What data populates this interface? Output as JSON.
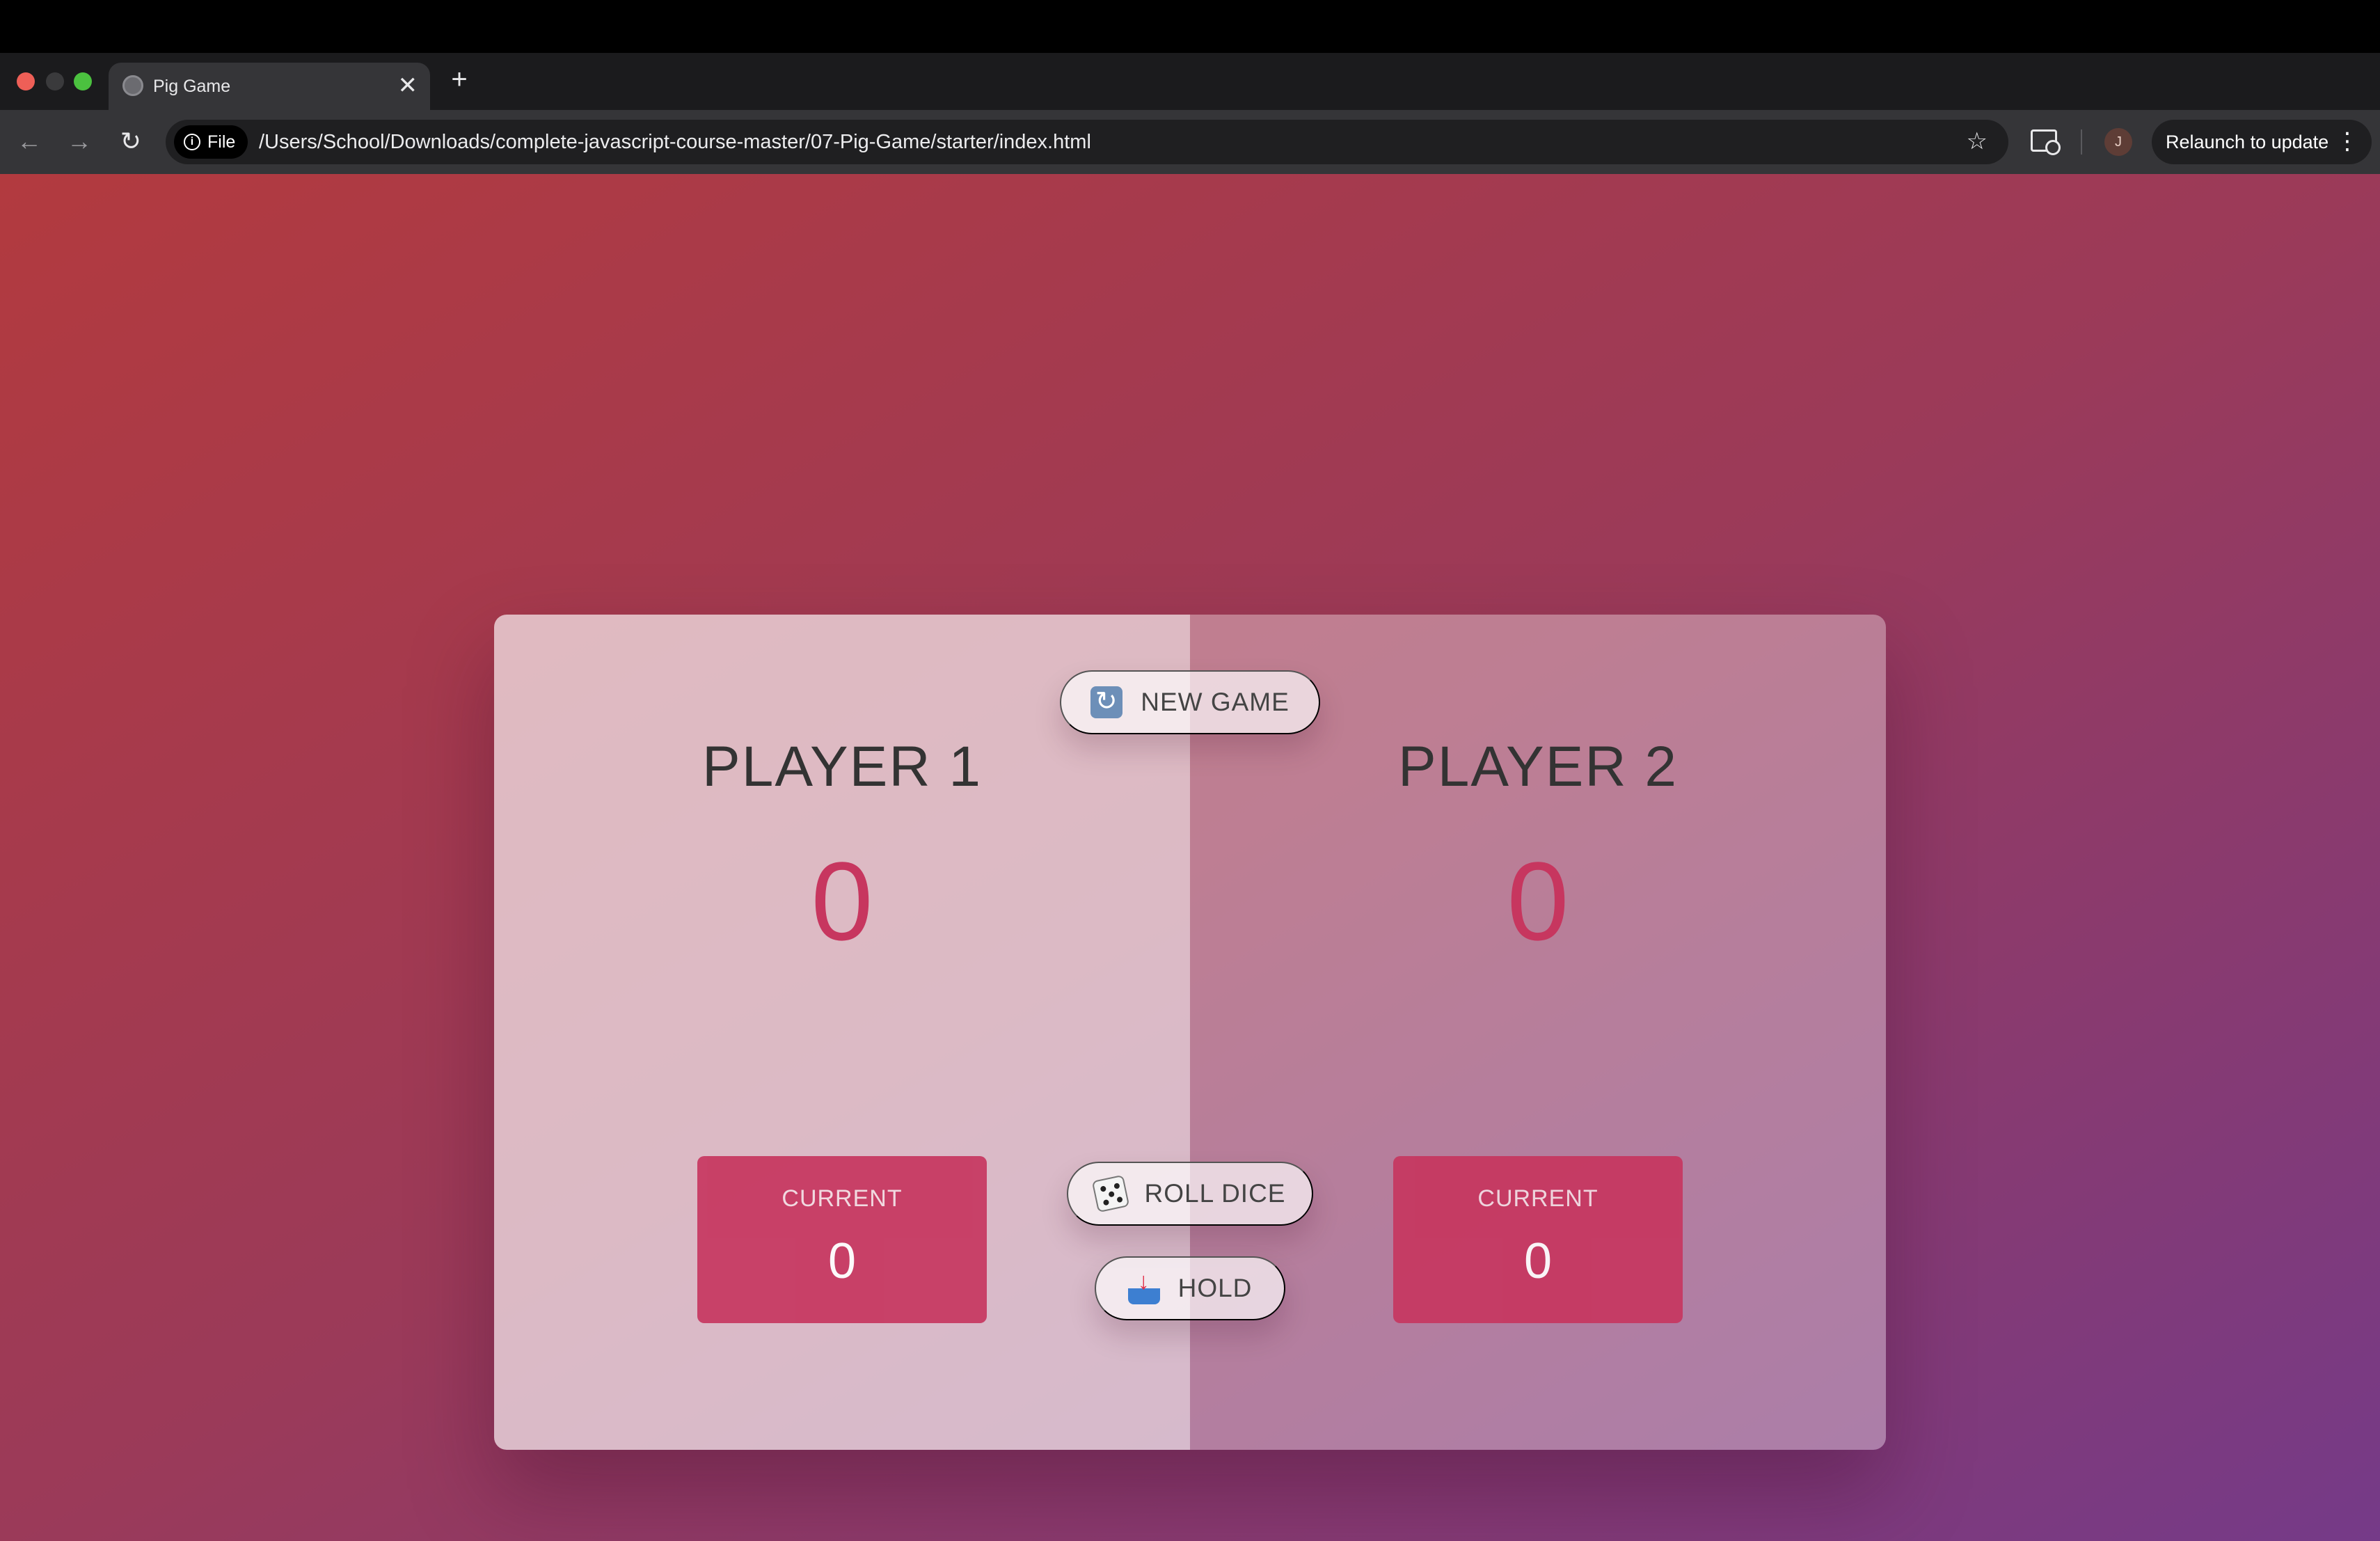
{
  "browser": {
    "tab_title": "Pig Game",
    "tab_close": "✕",
    "new_tab": "+",
    "back": "←",
    "forward": "→",
    "reload": "↻",
    "file_chip": "File",
    "info": "i",
    "url": "/Users/School/Downloads/complete-javascript-course-master/07-Pig-Game/starter/index.html",
    "bookmark": "☆",
    "avatar_initial": "J",
    "relaunch_label": "Relaunch to update",
    "menu": "⋮"
  },
  "game": {
    "new_game_label": "NEW GAME",
    "roll_dice_label": "ROLL DICE",
    "hold_label": "HOLD",
    "players": [
      {
        "name": "PLAYER 1",
        "score": "0",
        "current_label": "CURRENT",
        "current_score": "0"
      },
      {
        "name": "PLAYER 2",
        "score": "0",
        "current_label": "CURRENT",
        "current_score": "0"
      }
    ]
  },
  "colors": {
    "accent": "#c7365f",
    "gradient_start": "#b23a3f",
    "gradient_end": "#753a88"
  },
  "icons": [
    "refresh-icon",
    "dice-icon",
    "inbox-tray-icon",
    "info-icon",
    "star-icon",
    "cast-icon",
    "kebab-menu-icon"
  ]
}
